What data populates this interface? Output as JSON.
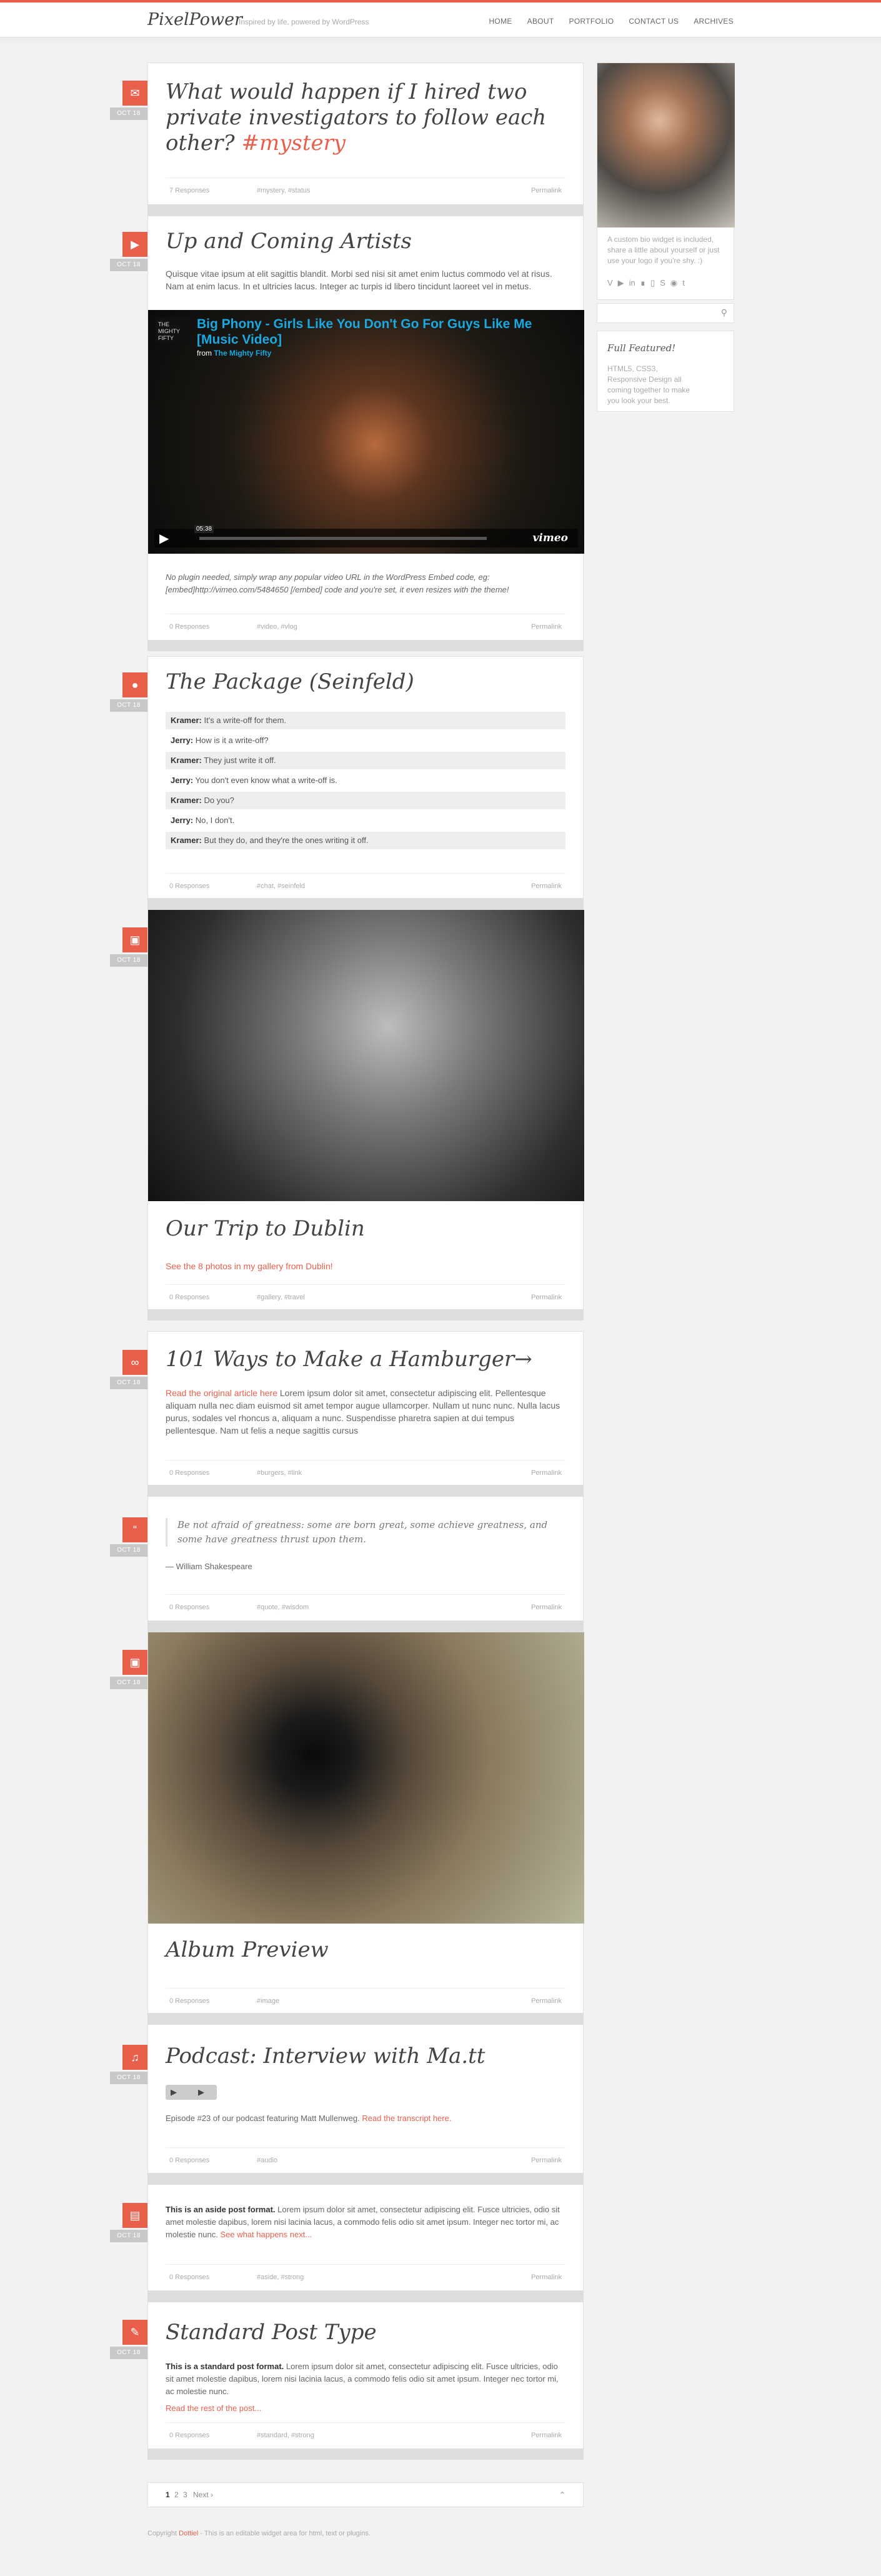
{
  "site": {
    "logo": "PixelPower",
    "tagline": "Inspired by life, powered by WordPress"
  },
  "nav": [
    "HOME",
    "ABOUT",
    "PORTFOLIO",
    "CONTACT US",
    "ARCHIVES"
  ],
  "posts": [
    {
      "date": "OCT 18",
      "icon": "megaphone-icon",
      "title": "What would happen if I hired two private investigators to follow each other?",
      "hashtag": "#mystery",
      "responses": "7 Responses",
      "tags": "#mystery, #status",
      "permalink": "Permalink"
    },
    {
      "date": "OCT 18",
      "icon": "video-icon",
      "title": "Up and Coming Artists",
      "text": "Quisque vitae ipsum at elit sagittis blandit. Morbi sed nisi sit amet enim luctus commodo vel at risus. Nam at enim lacus. In et ultricies lacus. Integer ac turpis id libero tincidunt laoreet vel in metus.",
      "video_title": "Big Phony - Girls Like You Don't Go For Guys Like Me [Music Video]",
      "video_from": "from",
      "video_channel": "The Mighty Fifty",
      "video_logo": "THE MIGHTY FIFTY",
      "video_time": "05:38",
      "video_brand": "vimeo",
      "note": "No plugin needed, simply wrap any popular video URL in the WordPress Embed code, eg: [embed]http://vimeo.com/5484650 [/embed] code and you're set, it even resizes with the theme!",
      "responses": "0 Responses",
      "tags": "#video, #vlog",
      "permalink": "Permalink"
    },
    {
      "date": "OCT 18",
      "icon": "chat-icon",
      "title": "The Package (Seinfeld)",
      "chat": [
        {
          "who": "Kramer:",
          "line": "It's a write-off for them."
        },
        {
          "who": "Jerry:",
          "line": "How is it a write-off?"
        },
        {
          "who": "Kramer:",
          "line": "They just write it off."
        },
        {
          "who": "Jerry:",
          "line": "You don't even know what a write-off is."
        },
        {
          "who": "Kramer:",
          "line": "Do you?"
        },
        {
          "who": "Jerry:",
          "line": "No, I don't."
        },
        {
          "who": "Kramer:",
          "line": "But they do, and they're the ones writing it off."
        }
      ],
      "responses": "0 Responses",
      "tags": "#chat, #seinfeld",
      "permalink": "Permalink"
    },
    {
      "date": "OCT 18",
      "icon": "image-icon",
      "title": "Our Trip to Dublin",
      "link": "See the 8 photos in my gallery from Dublin!",
      "responses": "0 Responses",
      "tags": "#gallery, #travel",
      "permalink": "Permalink"
    },
    {
      "date": "OCT 18",
      "icon": "link-icon",
      "title": "101 Ways to Make a Hamburger→",
      "link": "Read the original article here",
      "text": "Lorem ipsum dolor sit amet, consectetur adipiscing elit. Pellentesque aliquam nulla nec diam euismod sit amet tempor augue ullamcorper. Nullam ut nunc nunc. Nulla lacus purus, sodales vel rhoncus a, aliquam a nunc. Suspendisse pharetra sapien at dui tempus pellentesque. Nam ut felis a neque sagittis cursus",
      "responses": "0 Responses",
      "tags": "#burgers, #link",
      "permalink": "Permalink"
    },
    {
      "date": "OCT 18",
      "icon": "quote-icon",
      "quote": "Be not afraid of greatness: some are born great, some achieve greatness, and some have greatness thrust upon them.",
      "author": "— William Shakespeare",
      "responses": "0 Responses",
      "tags": "#quote, #wisdom",
      "permalink": "Permalink"
    },
    {
      "date": "OCT 18",
      "icon": "image-icon",
      "title": "Album Preview",
      "responses": "0 Responses",
      "tags": "#image",
      "permalink": "Permalink"
    },
    {
      "date": "OCT 18",
      "icon": "audio-icon",
      "title": "Podcast: Interview with Ma.tt",
      "text": "Episode #23 of our podcast featuring Matt Mullenweg.",
      "link": "Read the transcript here.",
      "responses": "0 Responses",
      "tags": "#audio",
      "permalink": "Permalink"
    },
    {
      "date": "OCT 18",
      "icon": "aside-icon",
      "bold": "This is an aside post format.",
      "text": "Lorem ipsum dolor sit amet, consectetur adipiscing elit. Fusce ultricies, odio sit amet molestie dapibus, lorem nisi lacinia lacus, a commodo felis odio sit amet ipsum. Integer nec tortor mi, ac molestie nunc.",
      "link": "See what happens next...",
      "responses": "0 Responses",
      "tags": "#aside, #strong",
      "permalink": "Permalink"
    },
    {
      "date": "OCT 18",
      "icon": "pencil-icon",
      "title": "Standard Post Type",
      "bold": "This is a standard post format.",
      "text": "Lorem ipsum dolor sit amet, consectetur adipiscing elit. Fusce ultricies, odio sit amet molestie dapibus, lorem nisi lacinia lacus, a commodo felis odio sit amet ipsum. Integer nec tortor mi, ac molestie nunc.",
      "link": "Read the rest of the post...",
      "responses": "0 Responses",
      "tags": "#standard, #strong",
      "permalink": "Permalink"
    }
  ],
  "pager": {
    "p1": "1",
    "p2": "2",
    "p3": "3",
    "next": "Next ›",
    "top": "⌃"
  },
  "sidebar": {
    "bio": "A custom bio widget is included, share a little about yourself or just use your logo if you're shy. :)",
    "search_placeholder": "",
    "featured_title": "Full Featured!",
    "featured_text": "HTML5, CSS3, Responsive Design all coming together to make you look your best."
  },
  "footer": {
    "copy": "Copyright",
    "brand": "Dottiel",
    "rest": "- This is an editable widget area for html, text or plugins."
  }
}
